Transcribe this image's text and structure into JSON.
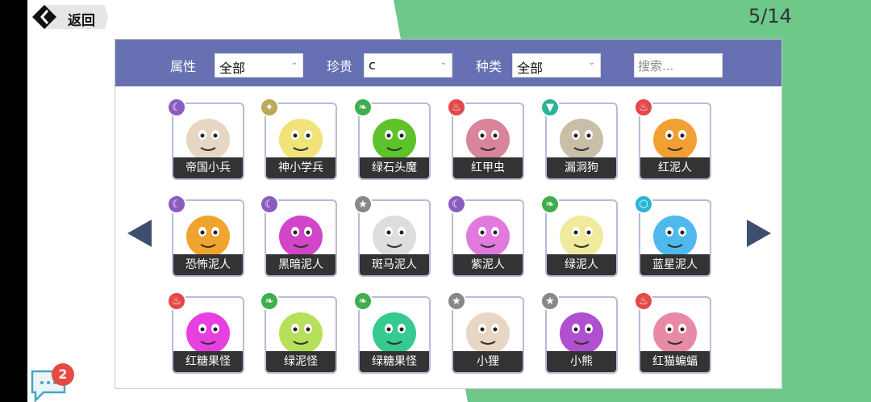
{
  "header": {
    "back_label": "返回",
    "page_indicator": "5/14"
  },
  "filters": {
    "attribute": {
      "label": "属性",
      "value": "全部"
    },
    "rarity": {
      "label": "珍贵",
      "value": "c"
    },
    "type": {
      "label": "种类",
      "value": "全部"
    },
    "search": {
      "placeholder": "搜索..."
    }
  },
  "element_colors": {
    "moon": "#8a5cc0",
    "star-gold": "#b9a95a",
    "leaf": "#3fae4f",
    "fire": "#e54848",
    "wind": "#2bb39a",
    "star-gray": "#888888",
    "hex": "#2bb4d6"
  },
  "monsters": [
    {
      "name": "帝国小兵",
      "element": "moon",
      "art_color": "#e8d6c4"
    },
    {
      "name": "神小学兵",
      "element": "star-gold",
      "art_color": "#f1e37a"
    },
    {
      "name": "绿石头魔",
      "element": "leaf",
      "art_color": "#5ec22a"
    },
    {
      "name": "红甲虫",
      "element": "fire",
      "art_color": "#d9849a"
    },
    {
      "name": "漏洞狗",
      "element": "wind",
      "art_color": "#c9bfa8"
    },
    {
      "name": "红泥人",
      "element": "fire",
      "art_color": "#f2a033"
    },
    {
      "name": "恐怖泥人",
      "element": "moon",
      "art_color": "#f0a430"
    },
    {
      "name": "黑暗泥人",
      "element": "moon",
      "art_color": "#d245c9"
    },
    {
      "name": "斑马泥人",
      "element": "star-gray",
      "art_color": "#dddddd"
    },
    {
      "name": "紫泥人",
      "element": "moon",
      "art_color": "#e279de"
    },
    {
      "name": "绿泥人",
      "element": "leaf",
      "art_color": "#f0ea9c"
    },
    {
      "name": "蓝星泥人",
      "element": "hex",
      "art_color": "#4fb8ee"
    },
    {
      "name": "红糖果怪",
      "element": "fire",
      "art_color": "#e83fe0"
    },
    {
      "name": "绿泥怪",
      "element": "leaf",
      "art_color": "#b6e05a"
    },
    {
      "name": "绿糖果怪",
      "element": "leaf",
      "art_color": "#36c990"
    },
    {
      "name": "小狸",
      "element": "star-gray",
      "art_color": "#e8d6c4"
    },
    {
      "name": "小熊",
      "element": "star-gray",
      "art_color": "#b04fcf"
    },
    {
      "name": "红猫蝙蝠",
      "element": "fire",
      "art_color": "#e88aa6"
    }
  ],
  "chat": {
    "unread_count": "2"
  }
}
